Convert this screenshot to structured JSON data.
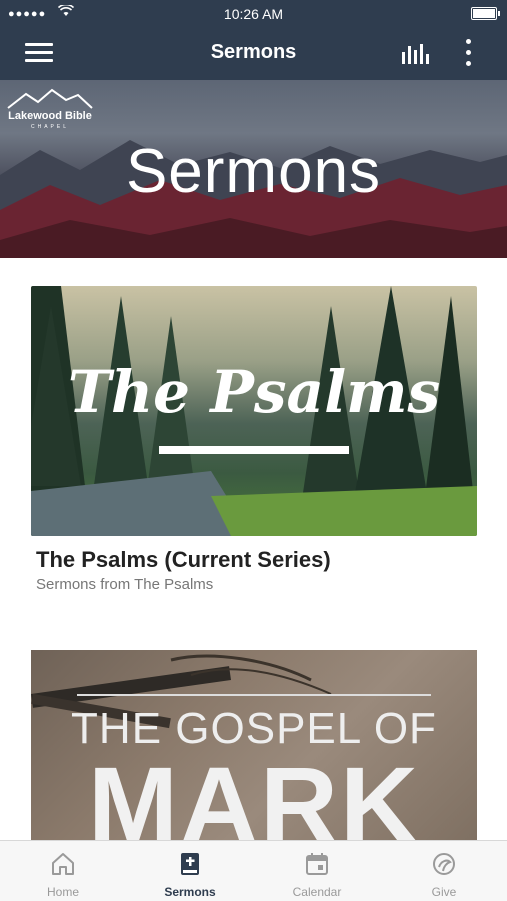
{
  "status": {
    "signal": "●●●●●",
    "time": "10:26 AM"
  },
  "nav": {
    "title": "Sermons"
  },
  "hero": {
    "logo_name": "Lakewood Bible",
    "logo_sub": "CHAPEL",
    "heading": "Sermons"
  },
  "series": [
    {
      "art_text": "The Psalms",
      "title": "The Psalms (Current Series)",
      "subtitle": "Sermons from The Psalms"
    },
    {
      "art_line1": "THE GOSPEL OF",
      "art_line2": "MARK"
    }
  ],
  "tabs": [
    {
      "label": "Home",
      "icon": "home-icon"
    },
    {
      "label": "Sermons",
      "icon": "bible-icon"
    },
    {
      "label": "Calendar",
      "icon": "calendar-icon"
    },
    {
      "label": "Give",
      "icon": "give-icon"
    }
  ],
  "colors": {
    "navbar": "#2f3d4f",
    "tab_inactive": "#9a9a9a",
    "tab_active": "#2f3d4f"
  }
}
